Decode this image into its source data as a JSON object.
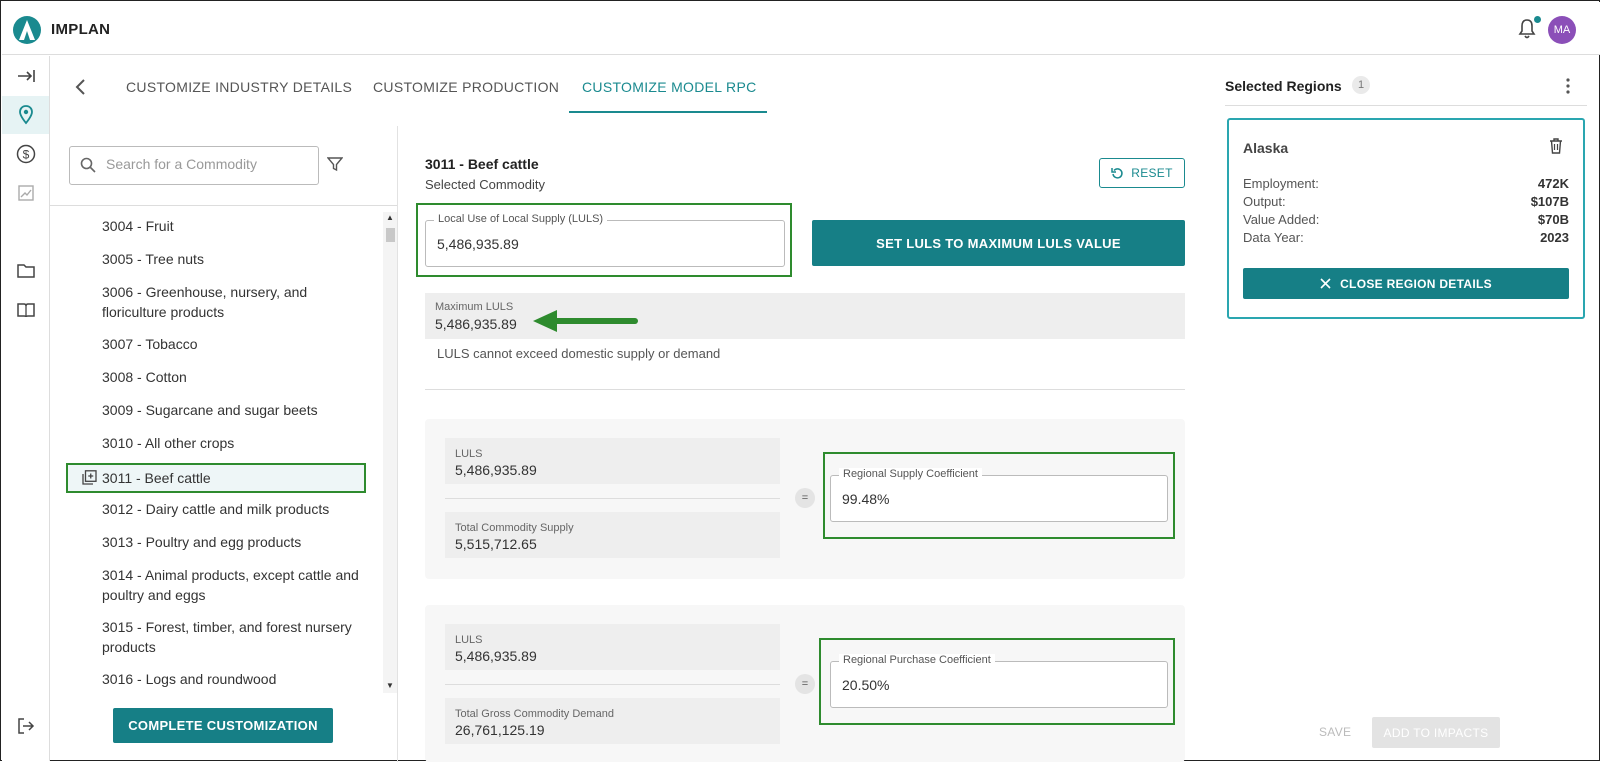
{
  "app": {
    "name": "IMPLAN",
    "avatar_initials": "MA"
  },
  "tabs": [
    {
      "label": "CUSTOMIZE INDUSTRY DETAILS"
    },
    {
      "label": "CUSTOMIZE PRODUCTION"
    },
    {
      "label": "CUSTOMIZE MODEL RPC",
      "active": true
    }
  ],
  "search": {
    "placeholder": "Search for a Commodity",
    "value": ""
  },
  "commodities": [
    {
      "label": "3004 - Fruit"
    },
    {
      "label": "3005 - Tree nuts"
    },
    {
      "label": "3006 - Greenhouse, nursery, and floriculture products"
    },
    {
      "label": "3007 - Tobacco"
    },
    {
      "label": "3008 - Cotton"
    },
    {
      "label": "3009 - Sugarcane and sugar beets"
    },
    {
      "label": "3010 - All other crops"
    },
    {
      "label": "3011 - Beef cattle",
      "selected": true
    },
    {
      "label": "3012 - Dairy cattle and milk products"
    },
    {
      "label": "3013 - Poultry and egg products"
    },
    {
      "label": "3014 - Animal products, except cattle and poultry and eggs"
    },
    {
      "label": "3015 - Forest, timber, and forest nursery products"
    },
    {
      "label": "3016 - Logs and roundwood"
    }
  ],
  "complete_label": "COMPLETE CUSTOMIZATION",
  "selected": {
    "title": "3011 - Beef cattle",
    "subtitle": "Selected Commodity"
  },
  "reset_label": "RESET",
  "luls_field": {
    "label": "Local Use of Local Supply (LULS)",
    "value": "5,486,935.89"
  },
  "set_max_label": "SET LULS TO MAXIMUM LULS VALUE",
  "max_luls": {
    "label": "Maximum LULS",
    "value": "5,486,935.89"
  },
  "note": "LULS cannot exceed domestic supply or demand",
  "rsc_card": {
    "luls_label": "LULS",
    "luls_value": "5,486,935.89",
    "supply_label": "Total Commodity Supply",
    "supply_value": "5,515,712.65",
    "eq": "=",
    "coef_label": "Regional Supply Coefficient",
    "coef_value": "99.48%"
  },
  "rpc_card": {
    "luls_label": "LULS",
    "luls_value": "5,486,935.89",
    "demand_label": "Total Gross Commodity Demand",
    "demand_value": "26,761,125.19",
    "eq": "=",
    "coef_label": "Regional Purchase Coefficient",
    "coef_value": "20.50%"
  },
  "footer": {
    "save_label": "SAVE",
    "add_label": "ADD TO IMPACTS"
  },
  "regions_panel": {
    "title": "Selected Regions",
    "count": "1"
  },
  "region": {
    "name": "Alaska",
    "stats": [
      {
        "key": "Employment:",
        "value": "472K"
      },
      {
        "key": "Output:",
        "value": "$107B"
      },
      {
        "key": "Value Added:",
        "value": "$70B"
      },
      {
        "key": "Data Year:",
        "value": "2023"
      }
    ],
    "close_label": "CLOSE REGION DETAILS"
  },
  "colors": {
    "accent": "#167f86",
    "highlight": "#2e8b2e",
    "avatar": "#8b4fb8"
  },
  "icons": [
    "implan-logo-icon",
    "bell-icon",
    "expand-icon",
    "location-pin-icon",
    "dollar-icon",
    "chart-icon",
    "folder-icon",
    "book-icon",
    "logout-icon",
    "back-chevron-icon",
    "search-icon",
    "filter-icon",
    "add-box-icon",
    "reset-icon",
    "arrow-left-icon",
    "kebab-icon",
    "trash-icon",
    "close-icon"
  ]
}
